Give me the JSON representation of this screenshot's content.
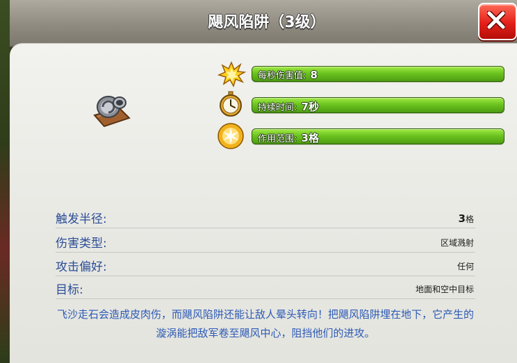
{
  "dialog": {
    "title": "飓风陷阱（3级）"
  },
  "stats": [
    {
      "icon": "explosion-icon",
      "label": "每秒伤害值: ",
      "value": "8",
      "fill_fraction": 1.0
    },
    {
      "icon": "stopwatch-icon",
      "label": "持续时间: ",
      "value": "7秒",
      "fill_fraction": 1.0
    },
    {
      "icon": "radius-burst-icon",
      "label": "作用范围: ",
      "value": "3格",
      "fill_fraction": 1.0
    }
  ],
  "details": {
    "trigger_radius": {
      "label": "触发半径:",
      "value": "3",
      "unit": "格"
    },
    "damage_type": {
      "label": "伤害类型:",
      "value": "区域溅射"
    },
    "favorite_target": {
      "label": "攻击偏好:",
      "value": "任何"
    },
    "targets": {
      "label": "目标:",
      "value": "地面和空中目标"
    }
  },
  "description": "飞沙走石会造成皮肉伤，而飓风陷阱还能让敌人晕头转向！把飓风陷阱埋在地下，它产生的漩涡能把敌军卷至飓风中心，阻挡他们的进攻。",
  "colors": {
    "bar_green": "#6bc420",
    "label_blue": "#2a4c96",
    "desc_blue": "#2c5ab6",
    "close_red": "#e32019"
  }
}
